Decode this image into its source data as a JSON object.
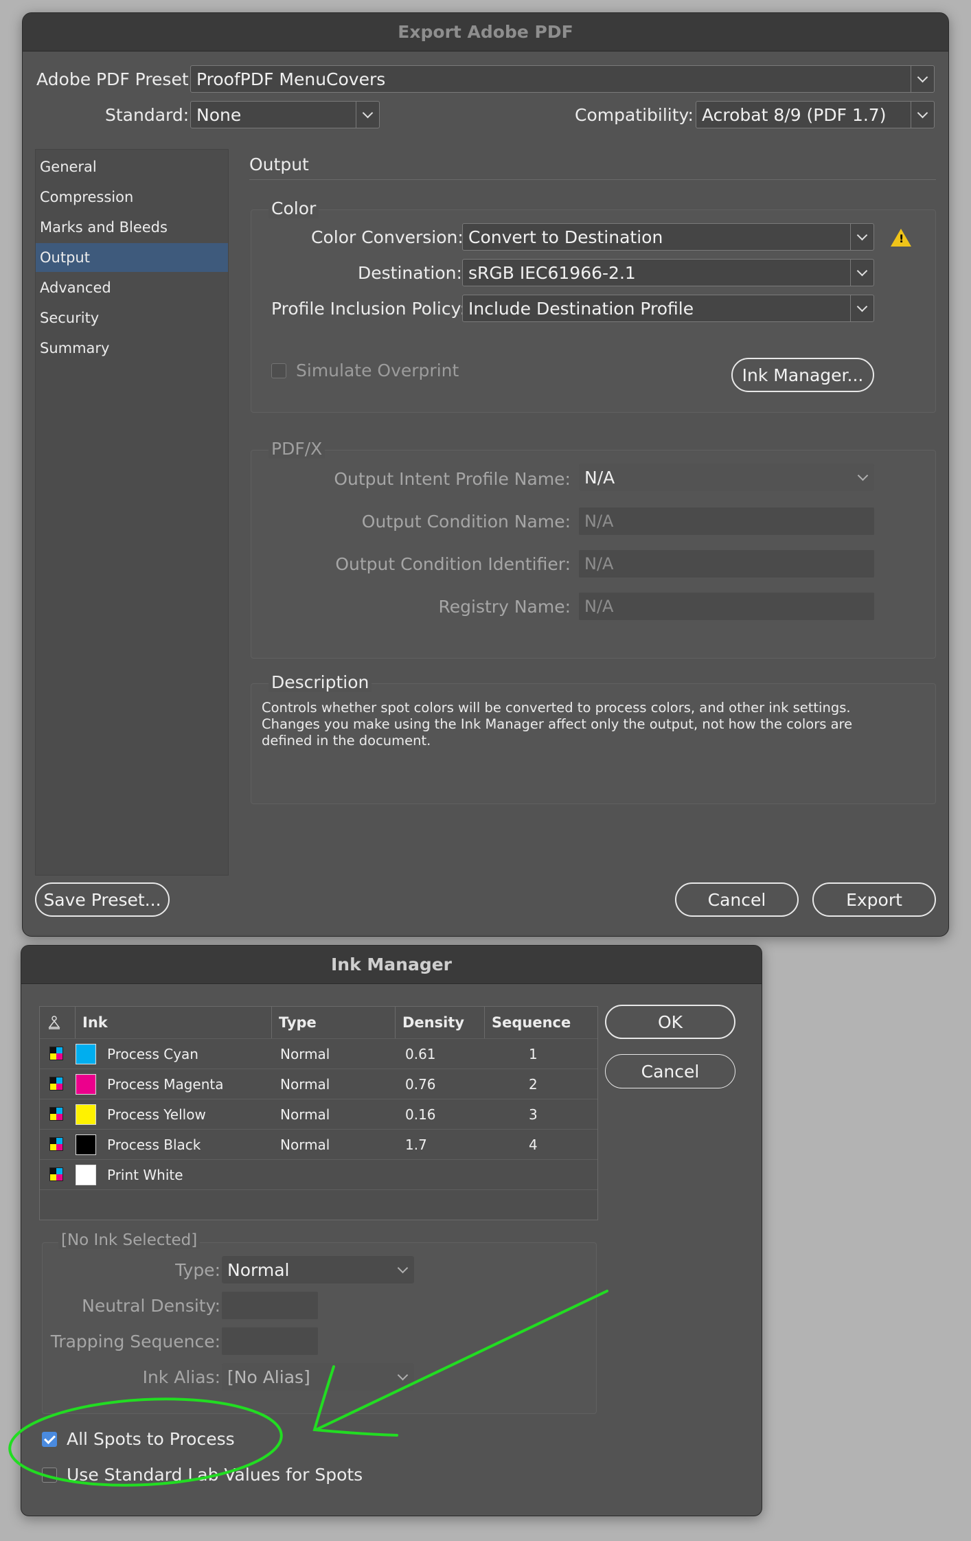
{
  "export_dialog": {
    "title": "Export Adobe PDF",
    "preset_label": "Adobe PDF Preset:",
    "preset_value": "ProofPDF MenuCovers",
    "standard_label": "Standard:",
    "standard_value": "None",
    "compat_label": "Compatibility:",
    "compat_value": "Acrobat 8/9 (PDF 1.7)",
    "sidebar": [
      "General",
      "Compression",
      "Marks and Bleeds",
      "Output",
      "Advanced",
      "Security",
      "Summary"
    ],
    "selected_sidebar": "Output",
    "section_title": "Output",
    "color": {
      "legend": "Color",
      "conversion_label": "Color Conversion:",
      "conversion_value": "Convert to Destination",
      "destination_label": "Destination:",
      "destination_value": "sRGB IEC61966-2.1",
      "policy_label": "Profile Inclusion Policy:",
      "policy_value": "Include Destination Profile",
      "simulate_label": "Simulate Overprint",
      "ink_manager_button": "Ink Manager..."
    },
    "pdfx": {
      "legend": "PDF/X",
      "intent_label": "Output Intent Profile Name:",
      "intent_value": "N/A",
      "condition_name_label": "Output Condition Name:",
      "condition_name_value": "N/A",
      "condition_id_label": "Output Condition Identifier:",
      "condition_id_value": "N/A",
      "registry_label": "Registry Name:",
      "registry_value": "N/A"
    },
    "description": {
      "legend": "Description",
      "line1": "Controls whether spot colors will be converted to process colors, and other ink settings.",
      "line2": "Changes you make using the Ink Manager affect only the output, not how the colors are",
      "line3": "defined in the document."
    },
    "save_preset_button": "Save Preset...",
    "cancel_button": "Cancel",
    "export_button": "Export"
  },
  "ink_manager": {
    "title": "Ink Manager",
    "columns": [
      "Ink",
      "Type",
      "Density",
      "Sequence"
    ],
    "inks": [
      {
        "name": "Process Cyan",
        "type": "Normal",
        "density": "0.61",
        "sequence": "1",
        "color": "#00aeef"
      },
      {
        "name": "Process Magenta",
        "type": "Normal",
        "density": "0.76",
        "sequence": "2",
        "color": "#ec008c"
      },
      {
        "name": "Process Yellow",
        "type": "Normal",
        "density": "0.16",
        "sequence": "3",
        "color": "#fff200"
      },
      {
        "name": "Process Black",
        "type": "Normal",
        "density": "1.7",
        "sequence": "4",
        "color": "#000000"
      },
      {
        "name": "Print White",
        "type": "",
        "density": "",
        "sequence": "",
        "color": "#ffffff"
      }
    ],
    "ok_button": "OK",
    "cancel_button": "Cancel",
    "selection_legend": "[No Ink Selected]",
    "type_label": "Type:",
    "type_value": "Normal",
    "neutral_density_label": "Neutral Density:",
    "trapping_label": "Trapping Sequence:",
    "alias_label": "Ink Alias:",
    "alias_value": "[No Alias]",
    "all_spots_label": "All Spots to Process",
    "all_spots_checked": true,
    "lab_values_label": "Use Standard Lab Values for Spots",
    "lab_values_checked": false
  },
  "annotation": {
    "color": "#22dd22"
  }
}
